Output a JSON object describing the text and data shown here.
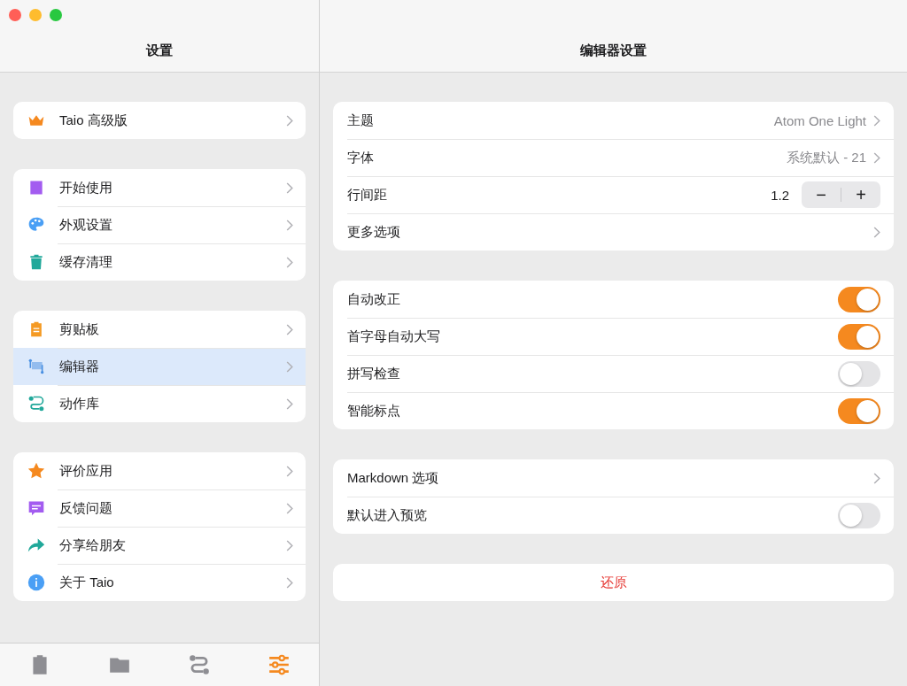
{
  "sidebar": {
    "title": "设置",
    "sections": [
      [
        {
          "label": "Taio 高级版",
          "selected": false
        }
      ],
      [
        {
          "label": "开始使用",
          "selected": false
        },
        {
          "label": "外观设置",
          "selected": false
        },
        {
          "label": "缓存清理",
          "selected": false
        }
      ],
      [
        {
          "label": "剪贴板",
          "selected": false
        },
        {
          "label": "编辑器",
          "selected": true
        },
        {
          "label": "动作库",
          "selected": false
        }
      ],
      [
        {
          "label": "评价应用",
          "selected": false
        },
        {
          "label": "反馈问题",
          "selected": false
        },
        {
          "label": "分享给朋友",
          "selected": false
        },
        {
          "label": "关于 Taio",
          "selected": false
        }
      ]
    ],
    "tabs": [
      {
        "selected": false
      },
      {
        "selected": false
      },
      {
        "selected": false
      },
      {
        "selected": true
      }
    ]
  },
  "detail": {
    "title": "编辑器设置",
    "sections": [
      [
        {
          "kind": "value",
          "label": "主题",
          "value": "Atom One Light"
        },
        {
          "kind": "value",
          "label": "字体",
          "value": "系统默认 - 21"
        },
        {
          "kind": "stepper",
          "label": "行间距",
          "value": "1.2",
          "minus": "−",
          "plus": "+"
        },
        {
          "kind": "link",
          "label": "更多选项"
        }
      ],
      [
        {
          "kind": "toggle",
          "label": "自动改正",
          "on": true
        },
        {
          "kind": "toggle",
          "label": "首字母自动大写",
          "on": true
        },
        {
          "kind": "toggle",
          "label": "拼写检查",
          "on": false
        },
        {
          "kind": "toggle",
          "label": "智能标点",
          "on": true
        }
      ],
      [
        {
          "kind": "link",
          "label": "Markdown 选项"
        },
        {
          "kind": "toggle",
          "label": "默认进入预览",
          "on": false
        }
      ]
    ],
    "reset_button": "还原"
  }
}
